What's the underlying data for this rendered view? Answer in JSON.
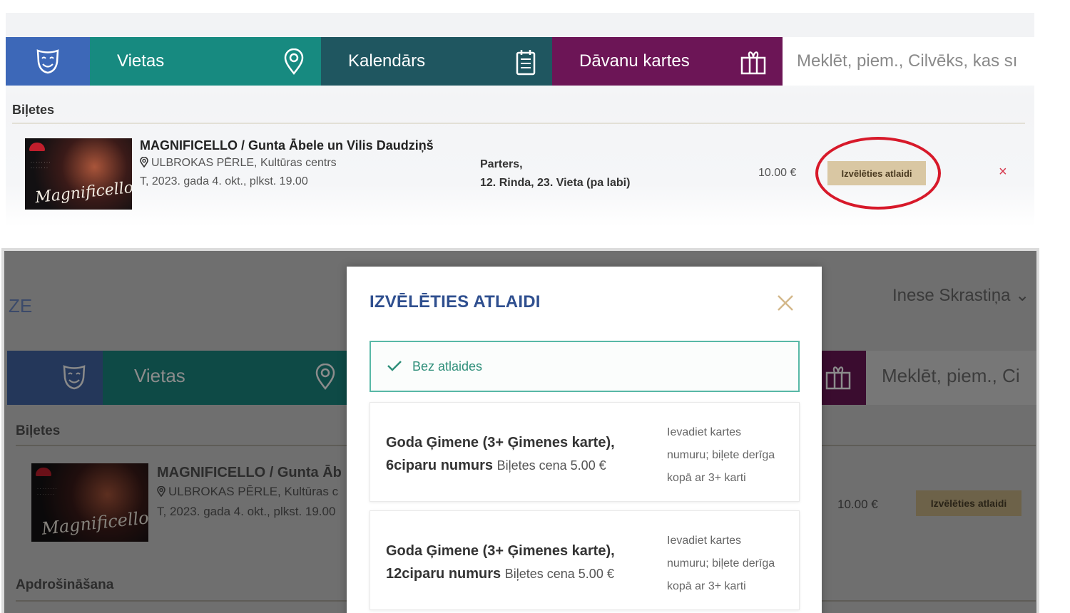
{
  "colors": {
    "home_blue": "#3d68b8",
    "vietas_teal": "#178a80",
    "kalendars_dark": "#1f5660",
    "davanu_purple": "#6c1556",
    "discount_btn": "#d9c7a3",
    "highlight_red": "#d7192a",
    "modal_title": "#2f4f8f",
    "selected_green": "#58b8a6"
  },
  "nav": {
    "home_icon": "theatre-mask-icon",
    "vietas": "Vietas",
    "vietas_icon": "location-pin-icon",
    "kalendars": "Kalendārs",
    "kalendars_icon": "calendar-icon",
    "davanu_kartes": "Dāvanu kartes",
    "davanu_icon": "gift-icon",
    "search_placeholder": "Meklēt, piem., Cilvēks, kas sı"
  },
  "tickets_section": "Biļetes",
  "event": {
    "title": "MAGNIFICELLO / Gunta Ābele un Vilis Daudziņš",
    "venue": "ULBROKAS PĒRLE, Kultūras centrs",
    "date": "T, 2023. gada 4. okt., plkst. 19.00",
    "seat_line1": "Parters,",
    "seat_line2": "12. Rinda, 23. Vieta (pa labi)",
    "price": "10.00 €",
    "discount_button": "Izvēlēties atlaidi",
    "poster_script": "Magnificello",
    "remove": "×"
  },
  "background": {
    "ze": "ZE",
    "user": "Inese Skrastiņa ⌄",
    "vietas": "Vietas",
    "search_placeholder": "Meklēt, piem., Ci",
    "tickets_section": "Biļetes",
    "event_title": "MAGNIFICELLO / Gunta Āb",
    "event_venue": "ULBROKAS PĒRLE, Kultūras c",
    "event_date": "T, 2023. gada 4. okt., plkst. 19.00",
    "price": "10.00 €",
    "discount_button": "Izvēlēties atlaidi",
    "insurance_section": "Apdrošināšana"
  },
  "modal": {
    "title": "IZVĒLĒTIES ATLAIDI",
    "selected_option": "Bez atlaides",
    "options": [
      {
        "name_line1": "Goda Ģimene (3+ Ģimenes karte),",
        "name_line2": "6ciparu numurs",
        "price": "Biļetes cena 5.00 €",
        "note_line1": "Ievadiet kartes",
        "note_line2": "numuru; biļete derīga",
        "note_line3": "kopā ar 3+ karti"
      },
      {
        "name_line1": "Goda Ģimene (3+ Ģimenes karte),",
        "name_line2": "12ciparu numurs",
        "price": "Biļetes cena 5.00 €",
        "note_line1": "Ievadiet kartes",
        "note_line2": "numuru; biļete derīga",
        "note_line3": "kopā ar 3+ karti"
      }
    ]
  }
}
